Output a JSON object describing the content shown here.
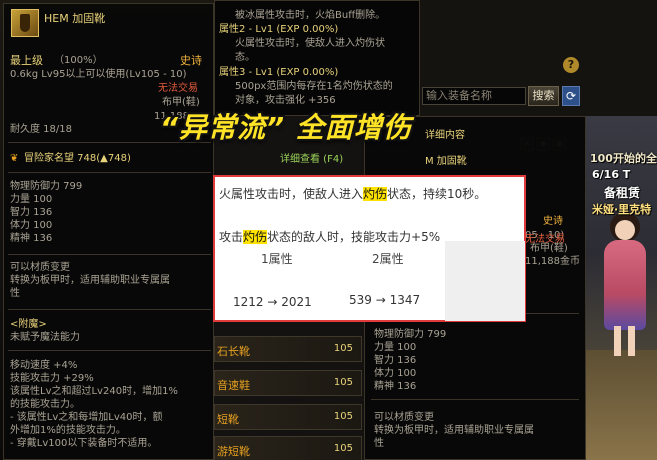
{
  "left_panel": {
    "item_name": "HEM 加固靴",
    "grade": "最上级",
    "grade_pct": "（100%）",
    "rarity": "史诗",
    "weight_req": "0.6kg  Lv95以上可以使用(Lv105 - 10)",
    "no_trade": "无法交易",
    "armor_type": "布甲(鞋)",
    "price": "11,188",
    "durability": "耐久度 18/18",
    "fame": "冒险家名望 748(▲748)",
    "stats": [
      "物理防御力 799",
      "力量 100",
      "智力 136",
      "体力 100",
      "精神 136"
    ],
    "transmute": [
      "可以材质变更",
      "转换为板甲时，适用辅助职业专属属",
      "性"
    ],
    "enchant_title": "<附魔>",
    "enchant_value": "未赋予魔法能力",
    "effects": [
      "移动速度 +4%",
      "技能攻击力 +29%",
      "该属性Lv之和超过Lv240时，增加1%",
      "的技能攻击力。",
      "- 该属性Lv之和每增加Lv40时，额",
      "外增加1%的技能攻击力。",
      "- 穿戴Lv100以下装备时不适用。"
    ]
  },
  "mid_panel": {
    "lines": [
      "被冰属性攻击时，火焰Buff删除。",
      "属性2 - Lv1 (EXP 0.00%)",
      "火属性攻击时，使敌人进入灼伤状",
      "态。",
      "属性3 - Lv1 (EXP 0.00%)",
      "500px范围内每存在1名灼伤状态的",
      "对象，攻击强化 +356"
    ]
  },
  "search": {
    "placeholder": "输入装备名称",
    "button": "搜索",
    "help": "?"
  },
  "headline": "“异常流” 全面增伤",
  "detail_link": "详细查看 (F4)",
  "list": {
    "items": [
      {
        "name": "石长靴",
        "level": "105"
      },
      {
        "name": "音速鞋",
        "level": "105"
      },
      {
        "name": "短靴",
        "level": "105"
      },
      {
        "name": "游短靴",
        "level": "105"
      }
    ]
  },
  "right_panel": {
    "tab": "详细内容",
    "item_name": "M 加固靴",
    "rarity_suffix": "史诗",
    "lvl_suffix": "05 - 10)",
    "no_trade": "无法交易",
    "armor_type": "布甲(鞋)",
    "price": "11,188金币",
    "stats": [
      "物理防御力 799",
      "力量 100",
      "智力 136",
      "体力 100",
      "精神 136"
    ],
    "transmute": [
      "可以材质变更",
      "转换为板甲时，适用辅助职业专属属",
      "性"
    ]
  },
  "scene": {
    "text1": "100开始的全",
    "text2": "备租赁",
    "text3": "米娅·里克特",
    "date": "6/16 T"
  },
  "popup": {
    "line1_a": "火属性攻击时，使敌人进入",
    "line1_hl": "灼伤",
    "line1_b": "状态，持续10秒。",
    "line2_a": "攻击",
    "line2_hl": "灼伤",
    "line2_b": "状态的敌人时，技能攻击力+5%",
    "col1_head": "1属性",
    "col2_head": "2属性",
    "col1_val": "1212 → 2021",
    "col2_val": "539 → 1347"
  },
  "colors": {
    "popup_border": "#e03a3a",
    "highlight": "#ffe300",
    "headline": "#ffe326",
    "epic": "#f2b43c"
  }
}
